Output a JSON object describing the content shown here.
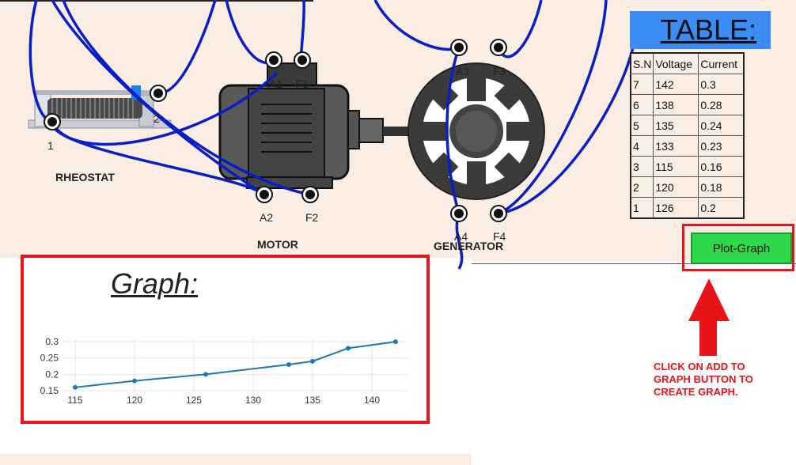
{
  "labels": {
    "rheostat": "RHEOSTAT",
    "motor": "MOTOR",
    "generator": "GENERATOR",
    "terminal_1": "1",
    "terminal_2": "2",
    "a1": "A1",
    "f1": "F1",
    "a2": "A2",
    "f2": "F2",
    "a3": "A3",
    "f3": "F3",
    "a4": "A4",
    "f4": "F4"
  },
  "table": {
    "title": "TABLE:",
    "headers": [
      "S.N",
      "Voltage",
      "Current"
    ],
    "rows": [
      [
        "7",
        "142",
        "0.3"
      ],
      [
        "6",
        "138",
        "0.28"
      ],
      [
        "5",
        "135",
        "0.24"
      ],
      [
        "4",
        "133",
        "0.23"
      ],
      [
        "3",
        "115",
        "0.16"
      ],
      [
        "2",
        "120",
        "0.18"
      ],
      [
        "1",
        "126",
        "0.2"
      ]
    ]
  },
  "plot_button": {
    "label": "Plot-Graph"
  },
  "instruction": {
    "text": "CLICK ON ADD TO GRAPH BUTTON TO CREATE GRAPH."
  },
  "graph": {
    "title": "Graph:"
  },
  "colors": {
    "wire": "#0a1ec8",
    "accent_red": "#e8141a",
    "button_green": "#2dd84a",
    "table_blue": "#3b8cf5",
    "line": "#1f77b4"
  },
  "chart_data": {
    "type": "line",
    "x": [
      115,
      120,
      126,
      133,
      135,
      138,
      142
    ],
    "y": [
      0.16,
      0.18,
      0.2,
      0.23,
      0.24,
      0.28,
      0.3
    ],
    "xticks": [
      115,
      120,
      125,
      130,
      135,
      140
    ],
    "yticks": [
      0.15,
      0.2,
      0.25,
      0.3
    ],
    "xlim": [
      114,
      143
    ],
    "ylim": [
      0.145,
      0.31
    ],
    "grid": true,
    "title": "",
    "xlabel": "",
    "ylabel": ""
  }
}
